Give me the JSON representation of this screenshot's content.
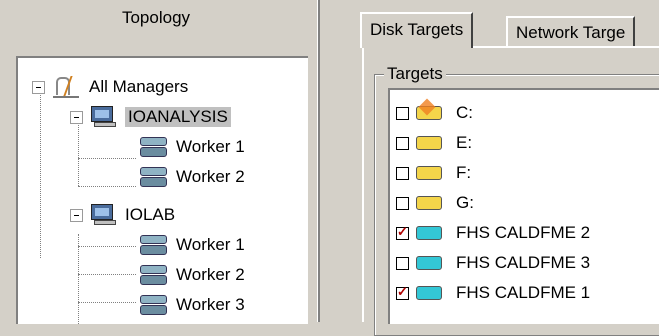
{
  "topology": {
    "title": "Topology",
    "root": {
      "label": "All Managers"
    },
    "managers": [
      {
        "label": "IOANALYSIS",
        "workers": [
          "Worker 1",
          "Worker 2"
        ]
      },
      {
        "label": "IOLAB",
        "workers": [
          "Worker 1",
          "Worker 2",
          "Worker 3"
        ]
      }
    ]
  },
  "tabs": [
    {
      "label": "Disk Targets"
    },
    {
      "label": "Network Targe"
    }
  ],
  "targets": {
    "group_label": "Targets",
    "items": [
      {
        "label": "C:",
        "checked": false,
        "disk_color": "#f4d54a"
      },
      {
        "label": "E:",
        "checked": false,
        "disk_color": "#f4d54a"
      },
      {
        "label": "F:",
        "checked": false,
        "disk_color": "#f4d54a"
      },
      {
        "label": "G:",
        "checked": false,
        "disk_color": "#f4d54a"
      },
      {
        "label": "FHS CALDFME 2",
        "checked": true,
        "disk_color": "#33c7d6"
      },
      {
        "label": "FHS CALDFME 3",
        "checked": false,
        "disk_color": "#33c7d6"
      },
      {
        "label": "FHS CALDFME 1",
        "checked": true,
        "disk_color": "#33c7d6"
      }
    ]
  }
}
